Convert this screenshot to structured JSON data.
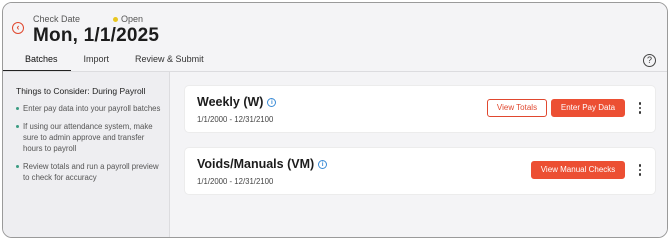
{
  "header": {
    "back_icon": "back-arrow-circle-icon",
    "check_date_label": "Check Date",
    "status": "Open",
    "status_color": "#e8c620",
    "title": "Mon, 1/1/2025",
    "accent_color": "#e0482f"
  },
  "tabs": [
    {
      "label": "Batches",
      "active": true
    },
    {
      "label": "Import",
      "active": false
    },
    {
      "label": "Review & Submit",
      "active": false
    }
  ],
  "help_icon": "question-circle-icon",
  "sidebar": {
    "title": "Things to Consider: During Payroll",
    "tips": [
      "Enter pay data into your payroll batches",
      "If using our attendance system, make sure to admin approve and transfer hours to payroll",
      "Review totals and run a payroll preview to check for accuracy"
    ],
    "bullet_color": "#3b9c82"
  },
  "batches": [
    {
      "title": "Weekly (W)",
      "date_range": "1/1/2000 - 12/31/2100",
      "buttons": {
        "secondary": "View Totals",
        "primary": "Enter Pay Data"
      }
    },
    {
      "title": "Voids/Manuals (VM)",
      "date_range": "1/1/2000 - 12/31/2100",
      "buttons": {
        "primary": "View Manual Checks"
      }
    }
  ]
}
